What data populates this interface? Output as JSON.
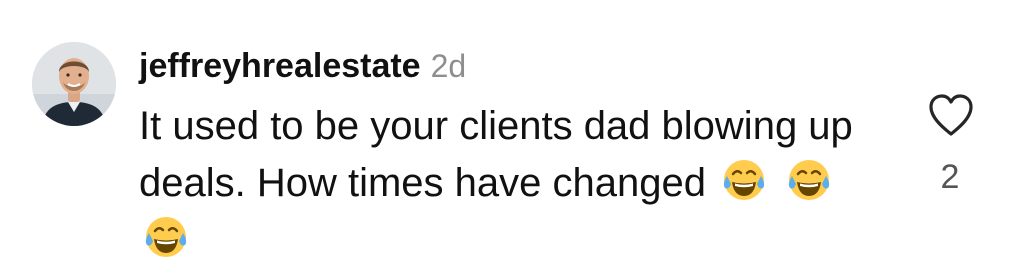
{
  "comment": {
    "username": "jeffreyhrealestate",
    "timestamp": "2d",
    "text": "It used to be your clients dad blowing up deals. How times have changed",
    "emojis": [
      "face-with-tears-of-joy",
      "face-with-tears-of-joy",
      "face-with-tears-of-joy"
    ],
    "like_icon": "heart-outline-icon",
    "like_count": "2"
  },
  "colors": {
    "text": "#111111",
    "muted": "#8e8e8e",
    "like_count": "#555555",
    "emoji_face": "#FFCC4D",
    "emoji_tears": "#5DADEC"
  }
}
